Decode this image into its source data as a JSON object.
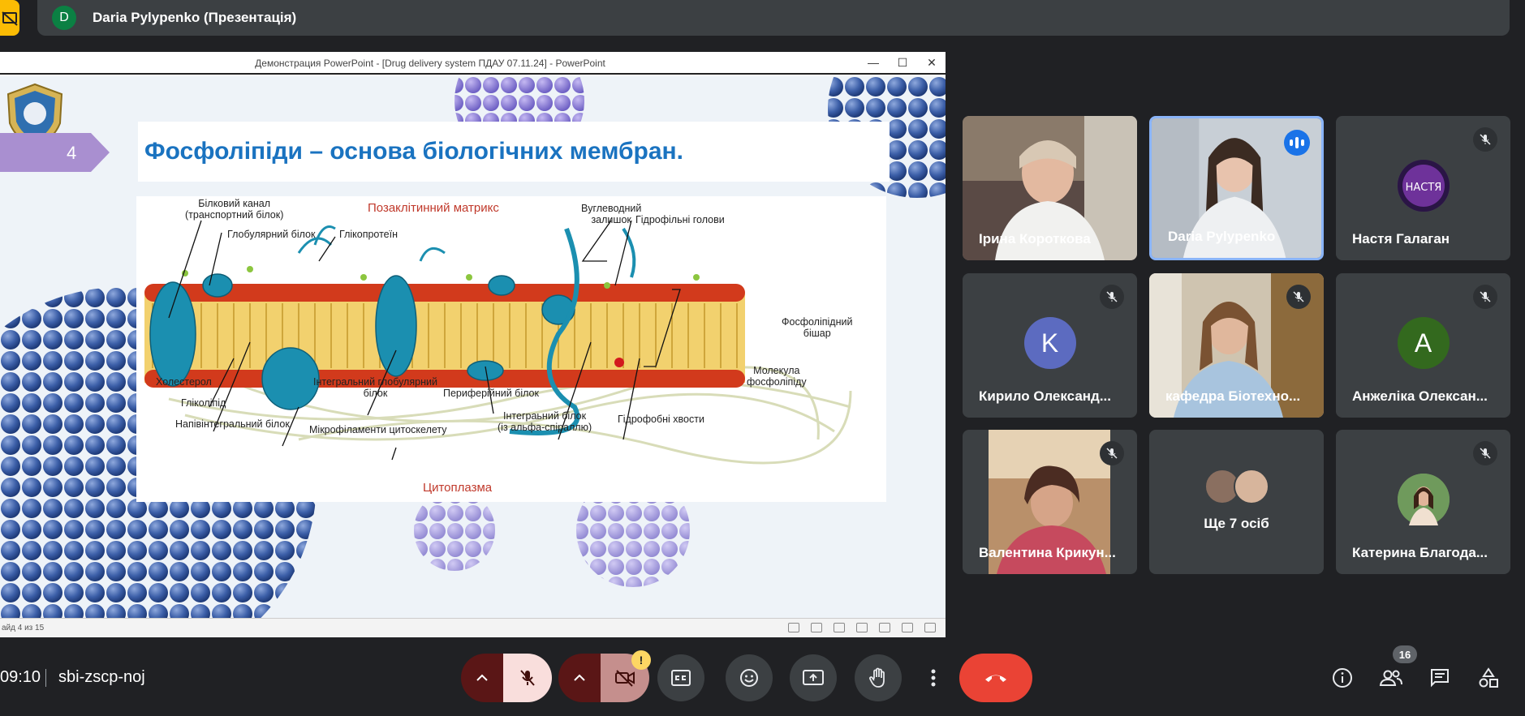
{
  "presenter": {
    "avatar_letter": "D",
    "name": "Daria Pylypenko (Презентація)"
  },
  "powerpoint": {
    "window_title": "Демонстрация PowerPoint - [Drug delivery system ПДАУ 07.11.24] - PowerPoint",
    "status_text": "айд 4 из 15",
    "slide": {
      "number": "4",
      "heading": "Фосфоліпіди – основа біологічних мембран.",
      "diagram_labels": {
        "extracellular": "Позаклітинний матрикс",
        "cytoplasm": "Цитоплазма",
        "protein_channel": "Білковий канал\n(транспортний білок)",
        "globular_protein": "Глобулярний білок",
        "glycoprotein": "Глікопротеїн",
        "carb_residue": "Вуглеводний\nзалишок",
        "hydrophilic_heads": "Гідрофільні голови",
        "phospholipid_bilayer": "Фосфоліпідний\nбішар",
        "phospholipid_molecule": "Молекула\nфосфоліпіду",
        "cholesterol": "Холестерол",
        "glycolipid": "Гліколіпід",
        "integral_globular": "Інтегральний глобулярний\nбілок",
        "peripheral_protein": "Периферійний білок",
        "integral_alpha": "Інтеграьний білок\n(із альфа-спіраллю)",
        "hydrophobic_tails": "Гідрофобні хвости",
        "semi_integral": "Напівінтегральний білок",
        "microfilaments": "Мікрофіламенти цитоскелету"
      }
    }
  },
  "participants": [
    {
      "name": "Ірина Короткова",
      "type": "video"
    },
    {
      "name": "Daria Pylypenko",
      "type": "video",
      "speaking": true
    },
    {
      "name": "Настя Галаган",
      "type": "avatar-image",
      "muted": true
    },
    {
      "name": "Кирило Олександ...",
      "type": "letter",
      "letter": "K",
      "color": "#5c6bc0",
      "muted": true
    },
    {
      "name": "кафедра Біотехно...",
      "type": "video",
      "muted": true
    },
    {
      "name": "Анжеліка Олексан...",
      "type": "letter",
      "letter": "A",
      "color": "#33691e",
      "muted": true
    },
    {
      "name": "Валентина Крикун...",
      "type": "video",
      "muted": true
    },
    {
      "name": "Ще 7 осіб",
      "type": "more"
    },
    {
      "name": "Катерина Благода...",
      "type": "avatar-image",
      "muted": true
    }
  ],
  "bottom": {
    "time": "09:10",
    "meeting_code": "sbi-zscp-noj",
    "people_count": "16",
    "camera_warning": "!"
  },
  "colors": {
    "end_call": "#ea4335",
    "mic_off_bg": "#f9dedc",
    "cam_off_bg": "#c58f8d",
    "active_border": "#8ab4f8"
  }
}
